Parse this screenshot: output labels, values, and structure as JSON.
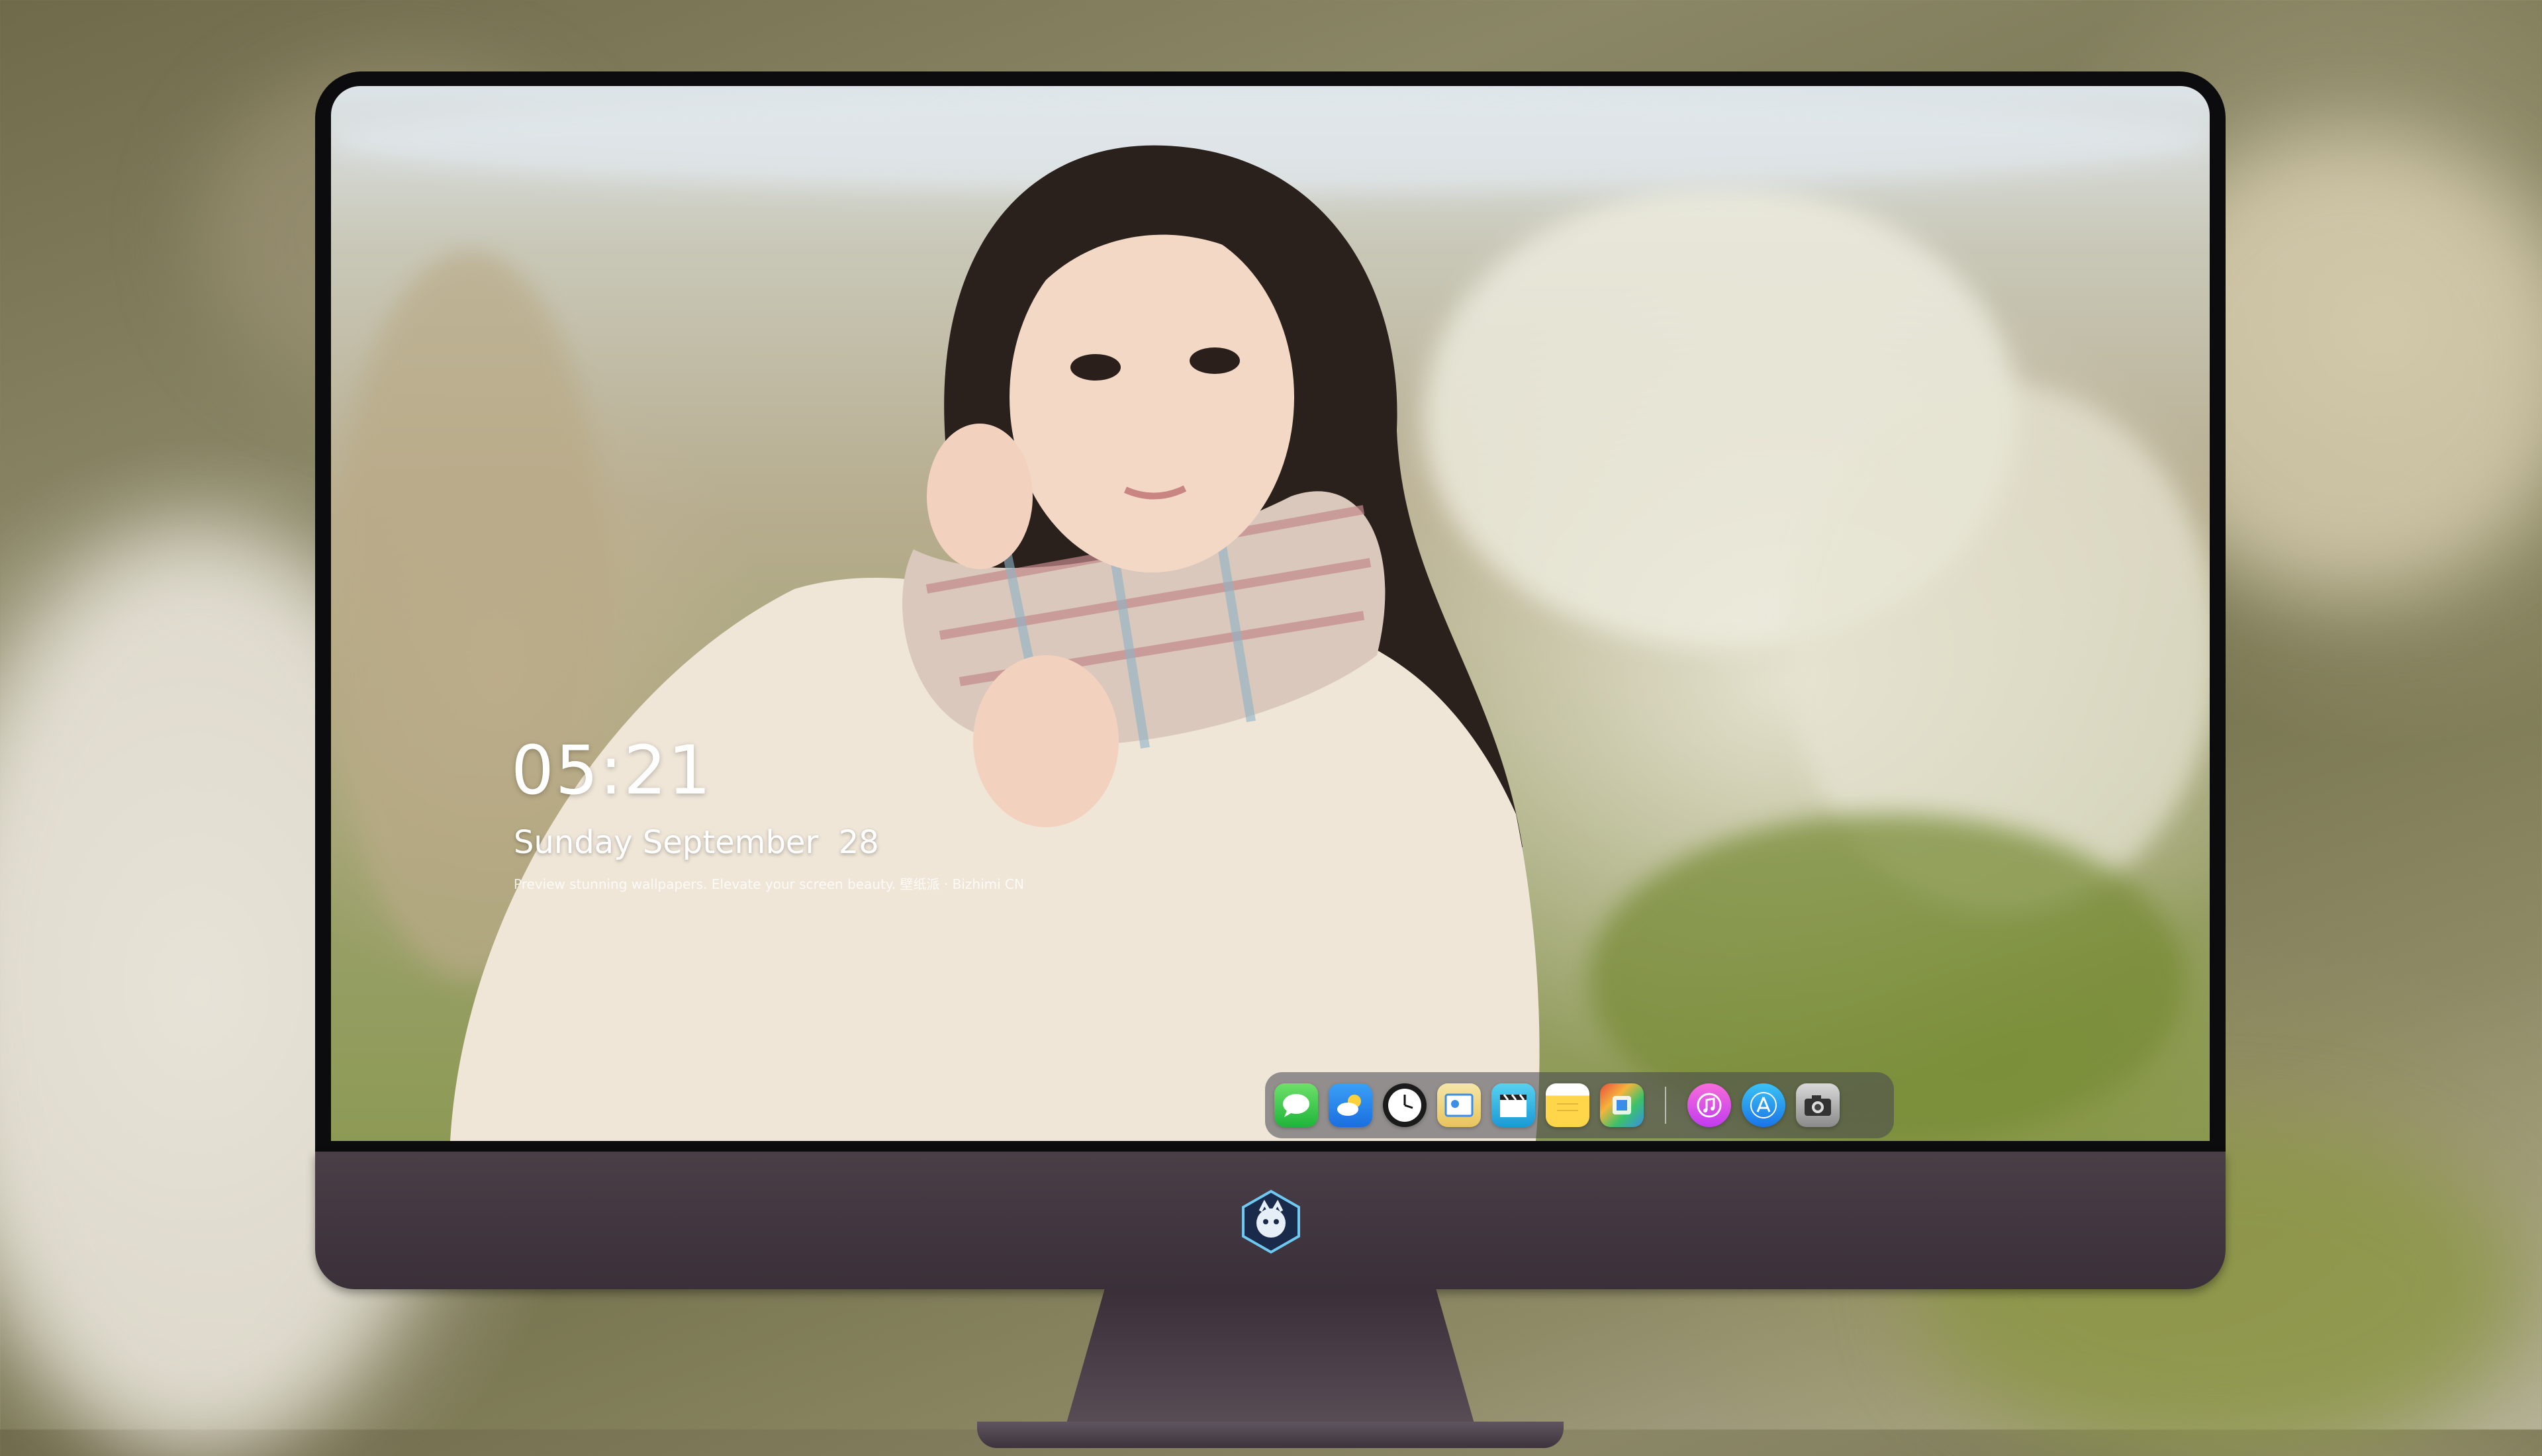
{
  "lock_screen": {
    "time": "05:21",
    "date": "Sunday September  28",
    "tagline": "Preview stunning wallpapers. Elevate your screen beauty. 壁纸派 · Bizhimi CN"
  },
  "dock": {
    "apps": [
      {
        "name": "messages",
        "glyph": "💬"
      },
      {
        "name": "weather",
        "glyph": "⛅"
      },
      {
        "name": "clock",
        "glyph": "🕐"
      },
      {
        "name": "preview",
        "glyph": "🖼"
      },
      {
        "name": "clips",
        "glyph": "🎬"
      },
      {
        "name": "notes",
        "glyph": "📝"
      },
      {
        "name": "photo-booth",
        "glyph": "📷"
      }
    ],
    "apps_right": [
      {
        "name": "itunes",
        "glyph": "♫"
      },
      {
        "name": "app-store",
        "glyph": "A"
      },
      {
        "name": "camera",
        "glyph": "◉"
      }
    ]
  },
  "colors": {
    "bezel": "#0c0b0d",
    "chin": "#4a3e47",
    "dock_bg": "rgba(70,70,80,.55)"
  }
}
